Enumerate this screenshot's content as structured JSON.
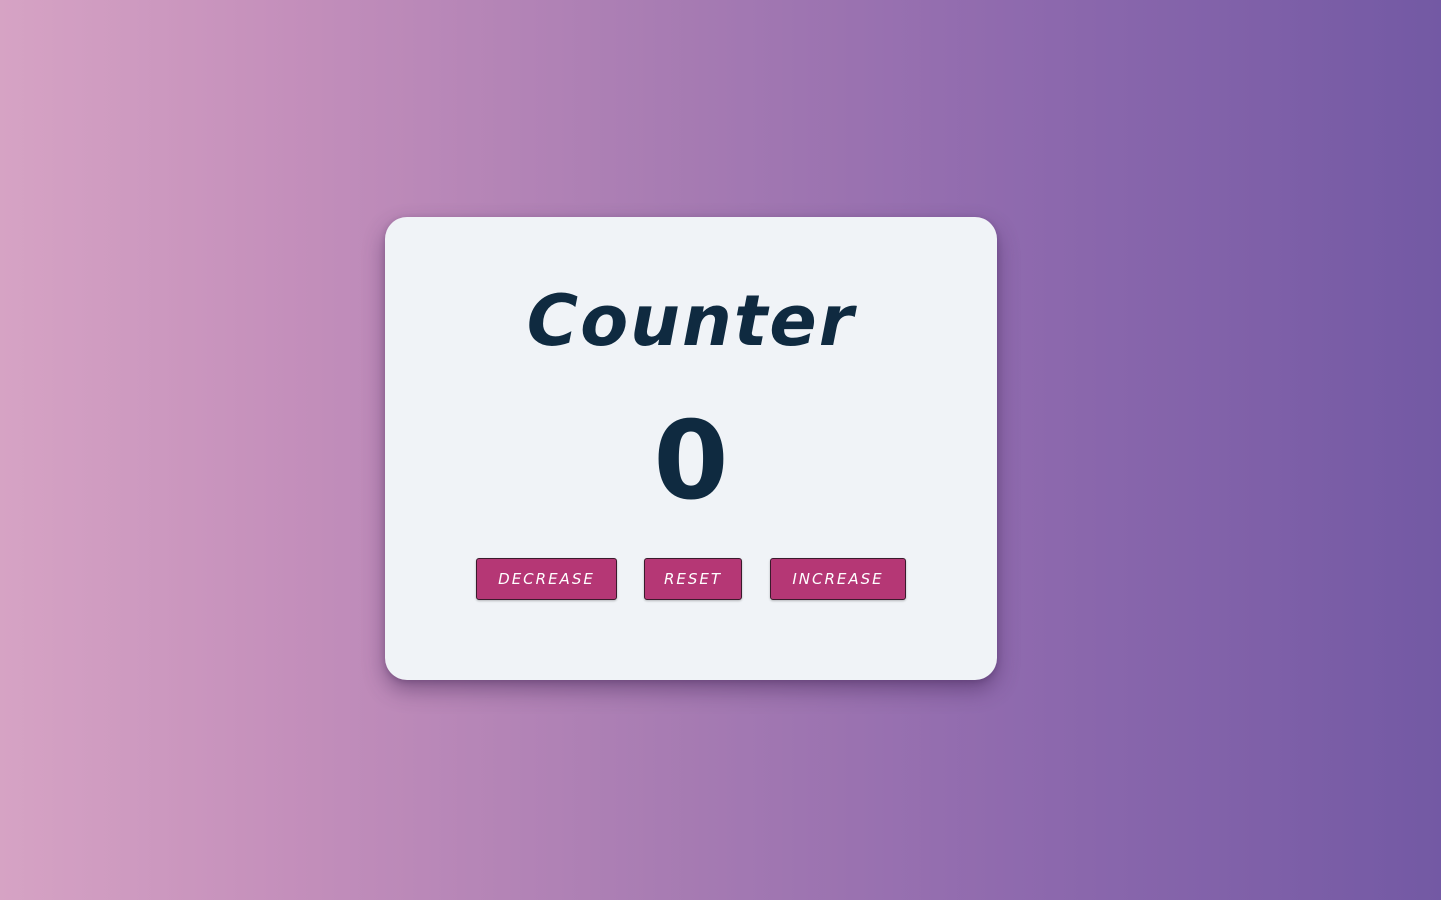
{
  "counter": {
    "title": "Counter",
    "value": "0"
  },
  "buttons": {
    "decrease_label": "Decrease",
    "reset_label": "Reset",
    "increase_label": "Increase"
  },
  "colors": {
    "background_gradient": [
      "#d6a3c4",
      "#7359a4"
    ],
    "card_background": "#f0f3f7",
    "text_color": "#0f2a40",
    "button_color": "#b53775"
  }
}
